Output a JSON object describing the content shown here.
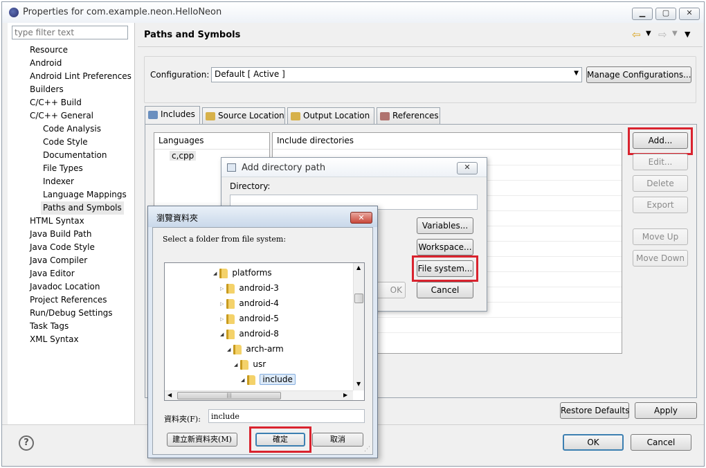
{
  "window": {
    "title": "Properties for com.example.neon.HelloNeon"
  },
  "sidebar": {
    "filter_placeholder": "type filter text",
    "items": [
      {
        "label": "Resource",
        "level": 0
      },
      {
        "label": "Android",
        "level": 0
      },
      {
        "label": "Android Lint Preferences",
        "level": 0
      },
      {
        "label": "Builders",
        "level": 0
      },
      {
        "label": "C/C++ Build",
        "level": 0
      },
      {
        "label": "C/C++ General",
        "level": 0
      },
      {
        "label": "Code Analysis",
        "level": 1
      },
      {
        "label": "Code Style",
        "level": 1
      },
      {
        "label": "Documentation",
        "level": 1
      },
      {
        "label": "File Types",
        "level": 1
      },
      {
        "label": "Indexer",
        "level": 1
      },
      {
        "label": "Language Mappings",
        "level": 1
      },
      {
        "label": "Paths and Symbols",
        "level": 1,
        "selected": true
      },
      {
        "label": "HTML Syntax",
        "level": 0
      },
      {
        "label": "Java Build Path",
        "level": 0
      },
      {
        "label": "Java Code Style",
        "level": 0
      },
      {
        "label": "Java Compiler",
        "level": 0
      },
      {
        "label": "Java Editor",
        "level": 0
      },
      {
        "label": "Javadoc Location",
        "level": 0
      },
      {
        "label": "Project References",
        "level": 0
      },
      {
        "label": "Run/Debug Settings",
        "level": 0
      },
      {
        "label": "Task Tags",
        "level": 0
      },
      {
        "label": "XML Syntax",
        "level": 0
      }
    ]
  },
  "page": {
    "heading": "Paths and Symbols",
    "configuration_label": "Configuration:",
    "configuration_value": "Default  [ Active ]",
    "manage_button": "Manage Configurations...",
    "tabs": [
      {
        "label": "Includes",
        "active": true,
        "icon": "includes-icon"
      },
      {
        "label": "Source Location",
        "icon": "folder-icon"
      },
      {
        "label": "Output Location",
        "icon": "folder-icon"
      },
      {
        "label": "References",
        "icon": "references-icon"
      }
    ],
    "languages_header": "Languages",
    "languages": [
      "c,cpp"
    ],
    "include_header": "Include directories",
    "side_buttons": {
      "add": "Add...",
      "edit": "Edit...",
      "delete": "Delete",
      "export": "Export",
      "move_up": "Move Up",
      "move_down": "Move Down"
    },
    "restore_defaults": "Restore Defaults",
    "apply": "Apply"
  },
  "footer": {
    "help": "?",
    "ok": "OK",
    "cancel": "Cancel"
  },
  "add_dir_dialog": {
    "title": "Add directory path",
    "directory_label": "Directory:",
    "directory_value": "",
    "variables": "Variables...",
    "workspace": "Workspace...",
    "file_system": "File system...",
    "ok_partial": "OK",
    "cancel": "Cancel"
  },
  "browse_dialog": {
    "title": "瀏覽資料夾",
    "prompt": "Select a folder from file system:",
    "tree": [
      {
        "label": "platforms",
        "indent": 0,
        "expanded": true
      },
      {
        "label": "android-3",
        "indent": 1,
        "expanded": false
      },
      {
        "label": "android-4",
        "indent": 1,
        "expanded": false
      },
      {
        "label": "android-5",
        "indent": 1,
        "expanded": false
      },
      {
        "label": "android-8",
        "indent": 1,
        "expanded": true
      },
      {
        "label": "arch-arm",
        "indent": 2,
        "expanded": true
      },
      {
        "label": "usr",
        "indent": 3,
        "expanded": true
      },
      {
        "label": "include",
        "indent": 4,
        "expanded": true,
        "selected": true
      }
    ],
    "folder_label": "資料夾(F):",
    "folder_value": "include",
    "new_folder": "建立新資料夾(M)",
    "confirm": "確定",
    "cancel": "取消"
  },
  "colors": {
    "highlight_red": "#d9232e",
    "selection": "#cce8ff",
    "default_button_border": "#3c7fb1"
  }
}
